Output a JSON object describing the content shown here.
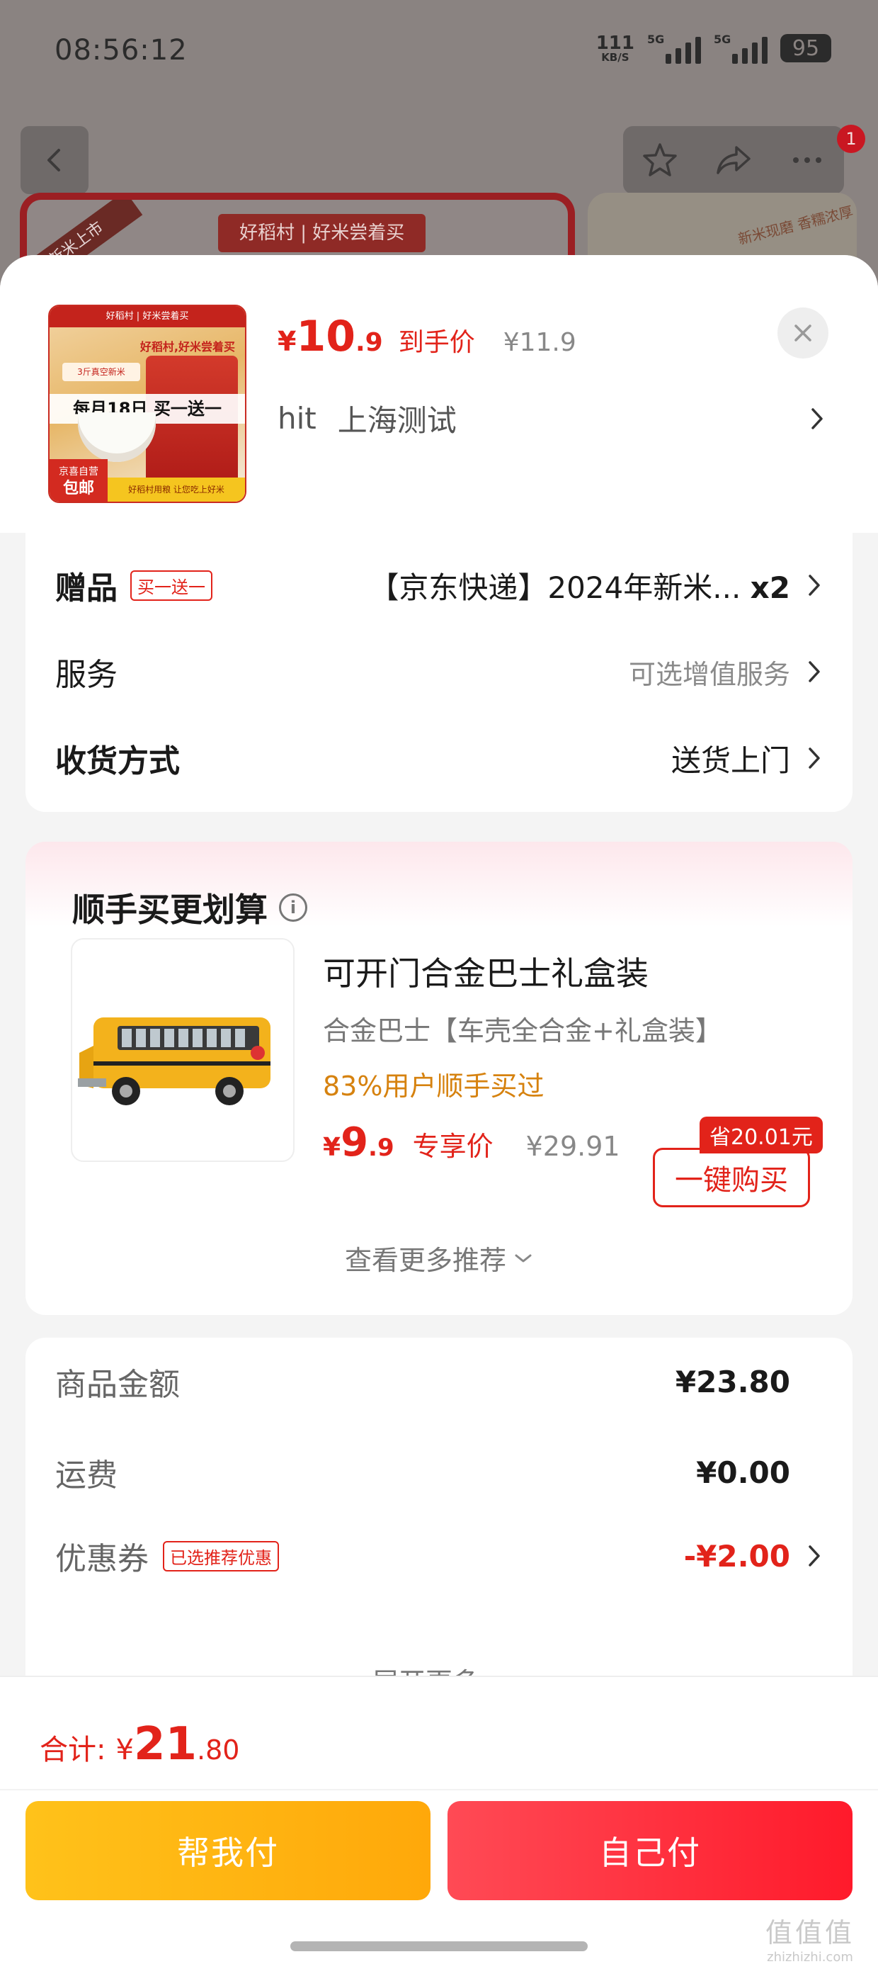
{
  "status_bar": {
    "time": "08:56:12",
    "net_speed": "111",
    "net_unit": "KB/S",
    "signal1_label": "5G",
    "signal2_label": "5G",
    "battery": "95"
  },
  "background": {
    "badge_count": "1",
    "ribbon_text": "新米上市",
    "brand_text": "好稻村 | 好米尝着买",
    "right_card_text": "新米现磨 香糯浓厚"
  },
  "product": {
    "image_top": "好稻村 | 好米尝着买",
    "image_slogan": "好稻村,好米尝着买",
    "image_mini": "3斤真空新米",
    "image_promo": "每月18日 买一送一",
    "image_free_line1": "京喜自营",
    "image_free_line2": "包邮",
    "image_strip": "好稻村用粮 让您吃上好米",
    "price_symbol": "¥",
    "price_int": "10",
    "price_dec": ".9",
    "price_label": "到手价",
    "orig_price": "¥11.9",
    "receiver_name": "hit",
    "receiver_address": "上海测试"
  },
  "options": {
    "gift_label": "赠品",
    "gift_tag": "买一送一",
    "gift_value": "【京东快递】2024年新米...",
    "gift_qty": "x2",
    "service_label": "服务",
    "service_value": "可选增值服务",
    "delivery_label": "收货方式",
    "delivery_value": "送货上门"
  },
  "recommend": {
    "title": "顺手买更划算",
    "item_name": "可开门合金巴士礼盒装",
    "item_desc": "合金巴士【车壳全合金+礼盒装】",
    "item_social": "83%用户顺手买过",
    "price_symbol": "¥",
    "price_int": "9",
    "price_dec": ".9",
    "price_label": "专享价",
    "orig_price": "¥29.91",
    "save_tag": "省20.01元",
    "buy_label": "一键购买",
    "more_label": "查看更多推荐"
  },
  "summary": {
    "goods_label": "商品金额",
    "goods_value": "¥23.80",
    "shipping_label": "运费",
    "shipping_value": "¥0.00",
    "coupon_label": "优惠券",
    "coupon_tag": "已选推荐优惠",
    "coupon_value": "-¥2.00",
    "expand_label": "展开更多"
  },
  "footer": {
    "total_label": "合计:",
    "total_symbol": "¥",
    "total_int": "21",
    "total_dec": ".80",
    "pay_friend_label": "帮我付",
    "pay_self_label": "自己付",
    "watermark_main": "值值值",
    "watermark_sub": "zhizhizhi.com"
  },
  "colors": {
    "accent_red": "#e2231a",
    "social_orange": "#d6820f",
    "pay_friend": "#ffb414",
    "pay_self": "#ff2a3a"
  },
  "icons": [
    "back-icon",
    "star-icon",
    "share-icon",
    "more-icon",
    "close-icon",
    "chevron-right-icon",
    "info-icon",
    "chevron-down-icon"
  ]
}
